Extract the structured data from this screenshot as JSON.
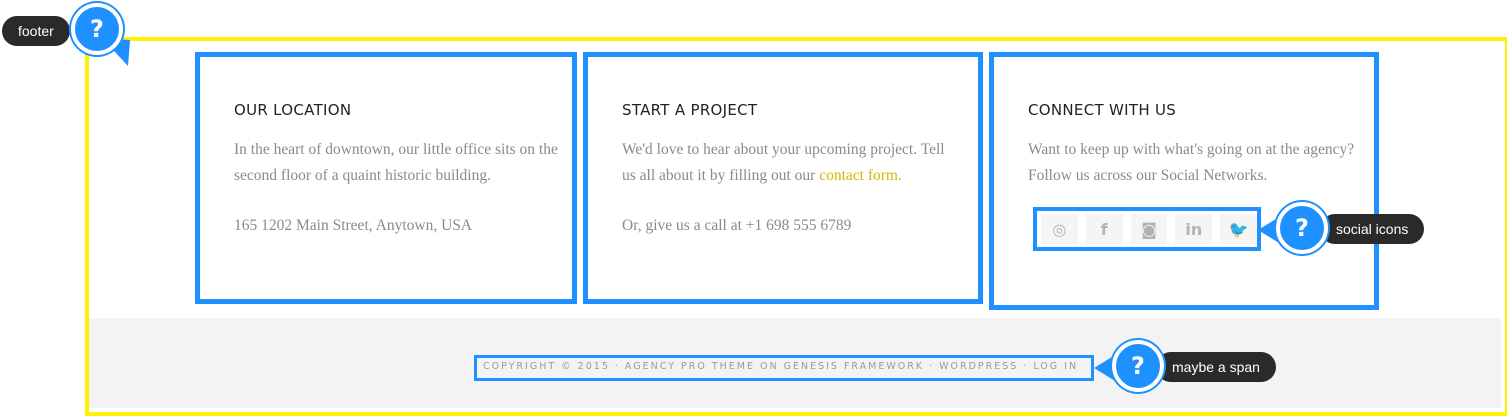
{
  "annotations": {
    "footer": "footer",
    "social": "social icons",
    "span": "maybe a span",
    "question": "?"
  },
  "widgets": [
    {
      "title": "OUR LOCATION",
      "p1": "In the heart of downtown, our little office sits on the second floor of a quaint historic building.",
      "p2": "165 1202 Main Street, Anytown, USA"
    },
    {
      "title": "START A PROJECT",
      "p1_before": "We'd love to hear about your upcoming project. Tell us all about it by filling out our ",
      "p1_link": "contact form.",
      "p2": "Or, give us a call at +1 698 555 6789"
    },
    {
      "title": "CONNECT WITH US",
      "p1": "Want to keep up with what's going on at the agency? Follow us across our Social Networks."
    }
  ],
  "social_icons": [
    {
      "name": "dribbble-icon",
      "glyph": "◎"
    },
    {
      "name": "facebook-icon",
      "glyph": "f"
    },
    {
      "name": "instagram-icon",
      "glyph": "◙"
    },
    {
      "name": "linkedin-icon",
      "glyph": "in"
    },
    {
      "name": "twitter-icon",
      "glyph": "🐦"
    }
  ],
  "copyright": "COPYRIGHT © 2015 · AGENCY PRO THEME ON GENESIS FRAMEWORK · WORDPRESS · LOG IN",
  "colors": {
    "outline_yellow": "#fff200",
    "annotation_blue": "#1e90ff",
    "link_yellow": "#d4b800"
  }
}
